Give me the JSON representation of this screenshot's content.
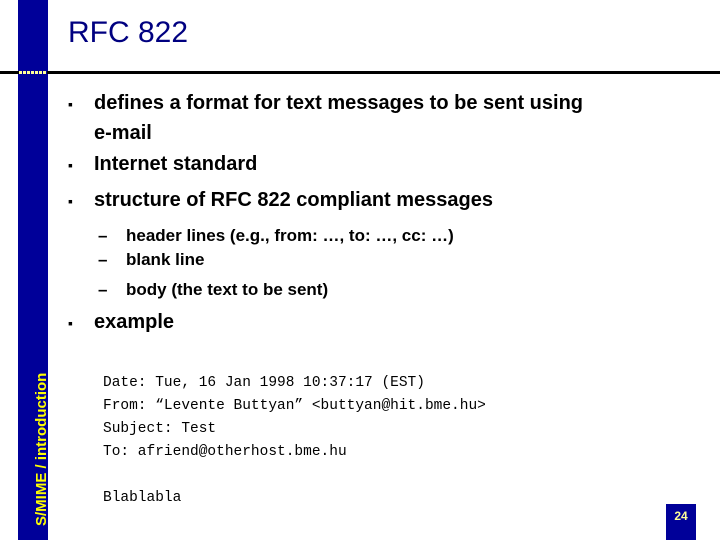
{
  "slide": {
    "title": "RFC 822",
    "sidebar_label": "S/MIME / introduction",
    "page_number": "24",
    "bullets": [
      {
        "marker": "▪",
        "lines": [
          "defines a format for text messages to be sent using",
          "e-mail"
        ]
      },
      {
        "marker": "▪",
        "lines": [
          "Internet standard"
        ]
      },
      {
        "marker": "▪",
        "lines": [
          "structure of RFC 822 compliant messages"
        ]
      }
    ],
    "sub_bullets": [
      {
        "marker": "–",
        "text": "header lines (e.g., from: …, to: …, cc: …)"
      },
      {
        "marker": "–",
        "text": "blank line"
      },
      {
        "marker": "–",
        "text": "body (the text to be sent)"
      }
    ],
    "example_bullet": {
      "marker": "▪",
      "text": "example"
    },
    "example_message": {
      "headers": [
        "Date: Tue, 16 Jan 1998 10:37:17 (EST)",
        "From: “Levente Buttyan” <buttyan@hit.bme.hu>",
        "Subject: Test",
        "To: afriend@otherhost.bme.hu"
      ],
      "body": "Blablabla"
    }
  },
  "colors": {
    "sidebar": "#000099",
    "title": "#000080",
    "sidebar_text": "#ffff00",
    "page_number_text": "#ffff99"
  }
}
